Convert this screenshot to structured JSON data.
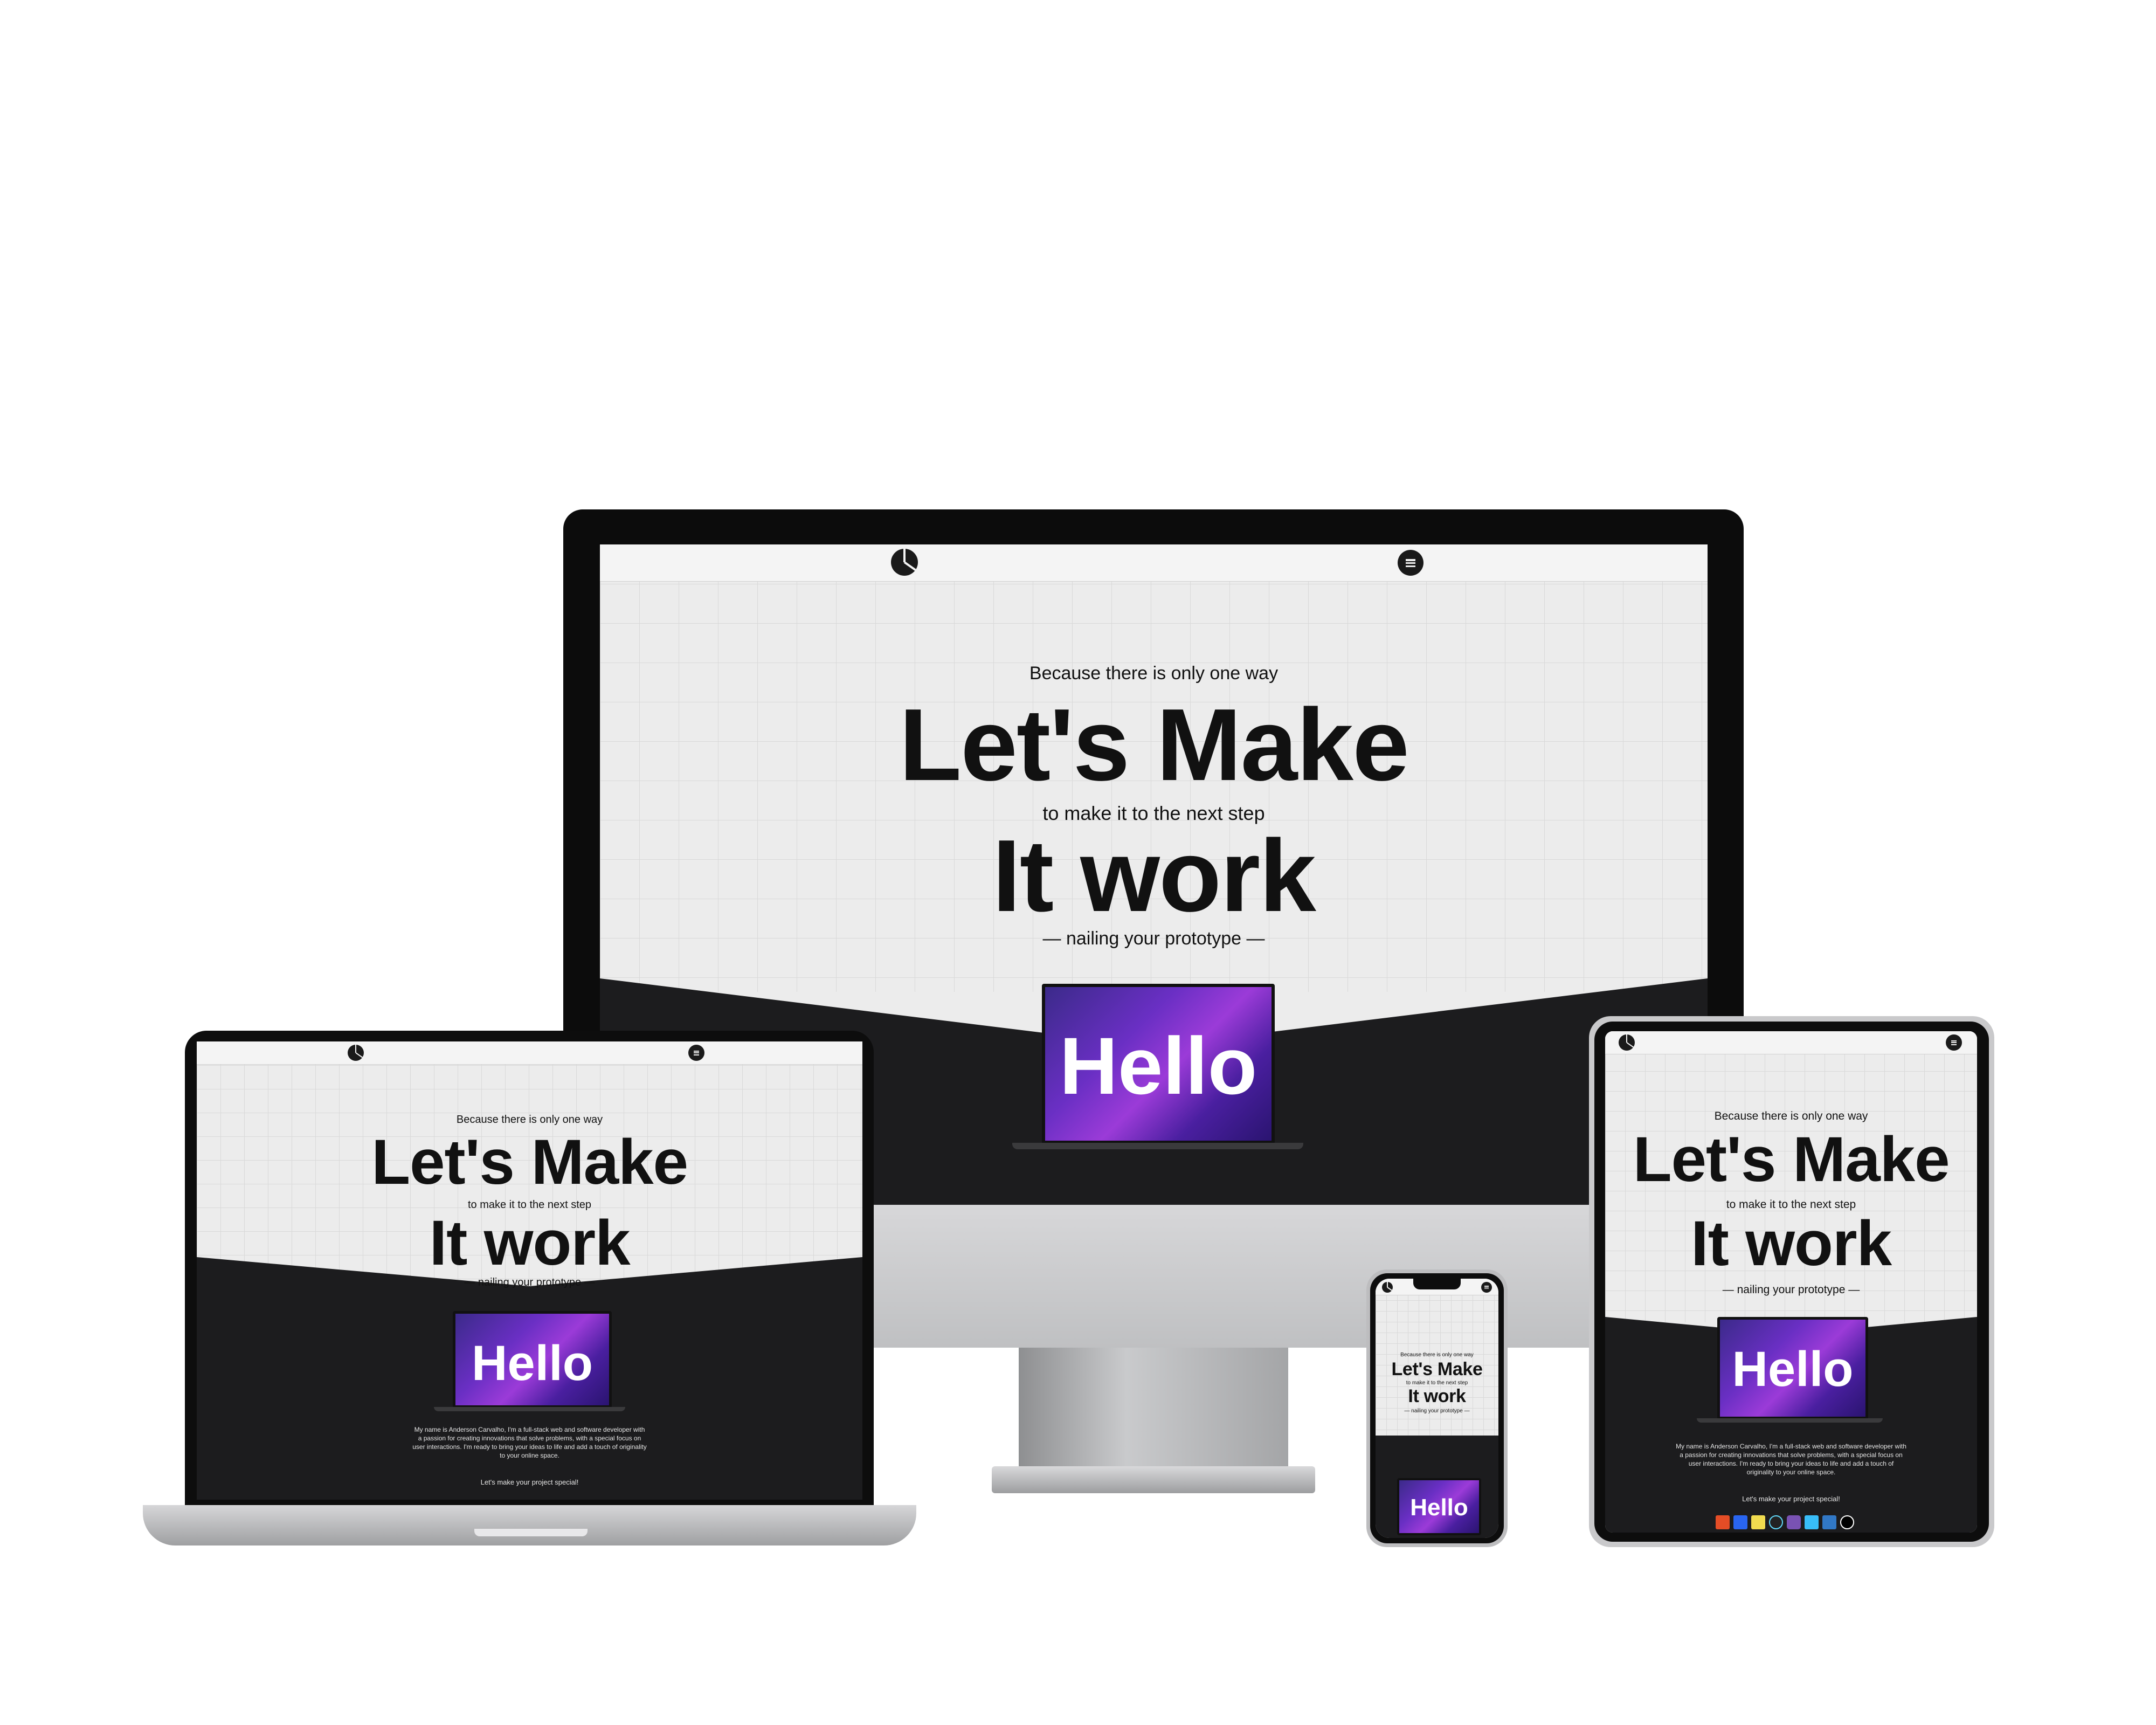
{
  "site": {
    "eyebrow": "Because there is only one way",
    "headline_1": "Let's Make",
    "connector": "to make it to the next step",
    "headline_2": "It work",
    "tagline": "— nailing your prototype —",
    "hello": "Hello",
    "bio": "My name is Anderson Carvalho, I'm a full-stack web and software developer with a passion for creating innovations that solve problems, with a special focus on user interactions. I'm ready to bring your ideas to life and add a touch of originality to your online space.",
    "cta": "Let's make your project special!",
    "tech_icons": [
      "html5-icon",
      "css3-icon",
      "javascript-icon",
      "react-icon",
      "bootstrap-icon",
      "tailwind-icon",
      "typescript-icon",
      "nextjs-icon"
    ]
  },
  "colors": {
    "page_bg": "#ececec",
    "dark_section": "#1c1c1e",
    "hello_purple": "#6a2fc4",
    "bezel": "#0d0d0d",
    "silver": "#c9c9cb"
  }
}
